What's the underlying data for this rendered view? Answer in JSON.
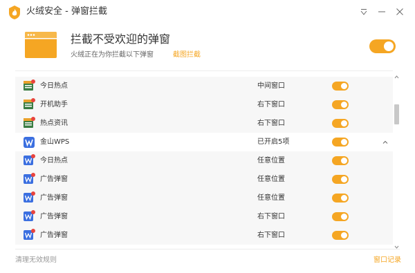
{
  "window": {
    "title": "火绒安全 - 弹窗拦截"
  },
  "header": {
    "title": "拦截不受欢迎的弹窗",
    "subtitle": "火绒正在为你拦截以下弹窗",
    "screenshot_link": "截图拦截",
    "master_toggle_on": true
  },
  "list": {
    "rows": [
      {
        "type": "item",
        "icon": "generic-app-icon",
        "name": "今日热点",
        "position": "中间窗口",
        "enabled": true
      },
      {
        "type": "item",
        "icon": "generic-app-icon",
        "name": "开机助手",
        "position": "右下窗口",
        "enabled": true
      },
      {
        "type": "item",
        "icon": "generic-app-icon",
        "name": "热点资讯",
        "position": "右下窗口",
        "enabled": true
      },
      {
        "type": "group",
        "icon": "wps-icon",
        "name": "金山WPS",
        "position": "已开启5项",
        "enabled": true,
        "expanded": true
      },
      {
        "type": "item",
        "icon": "wps-popup-icon",
        "name": "今日热点",
        "position": "任意位置",
        "enabled": true
      },
      {
        "type": "item",
        "icon": "wps-popup-icon",
        "name": "广告弹窗",
        "position": "任意位置",
        "enabled": true
      },
      {
        "type": "item",
        "icon": "wps-popup-icon",
        "name": "广告弹窗",
        "position": "任意位置",
        "enabled": true
      },
      {
        "type": "item",
        "icon": "wps-popup-icon",
        "name": "广告弹窗",
        "position": "右下窗口",
        "enabled": true
      },
      {
        "type": "item",
        "icon": "wps-popup-icon",
        "name": "广告弹窗",
        "position": "右下窗口",
        "enabled": true
      }
    ]
  },
  "footer": {
    "clean_rules": "清理无效规则",
    "popup_log": "窗口记录"
  },
  "colors": {
    "accent": "#f5a623",
    "wps_blue": "#3b6fe0",
    "badge_red": "#e8433d"
  }
}
